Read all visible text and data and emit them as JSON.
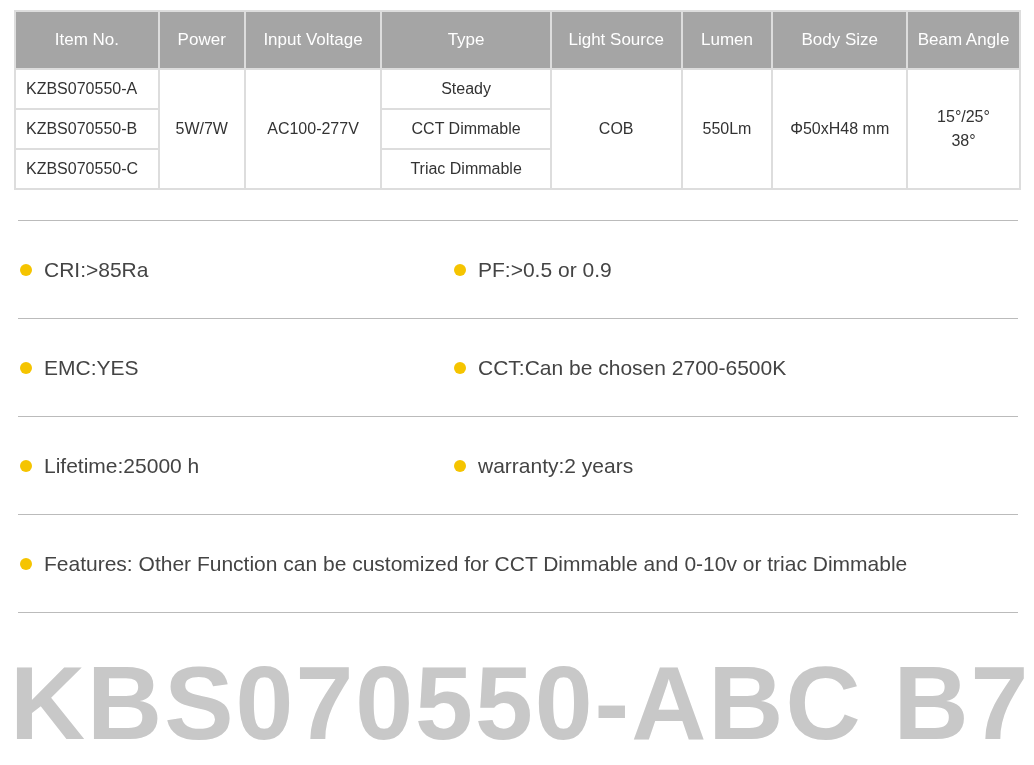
{
  "table": {
    "columns": [
      "Item No.",
      "Power",
      "Input Voltage",
      "Type",
      "Light Source",
      "Lumen",
      "Body Size",
      "Beam Angle"
    ],
    "item_numbers": [
      "KZBS070550-A",
      "KZBS070550-B",
      "KZBS070550-C"
    ],
    "power": "5W/7W",
    "input_voltage": "AC100-277V",
    "types": [
      "Steady",
      "CCT Dimmable",
      "Triac Dimmable"
    ],
    "light_source": "COB",
    "lumen": "550Lm",
    "body_size": "Φ50xH48 mm",
    "beam_angle": "15°/25°\n38°"
  },
  "features": [
    [
      "CRI:>85Ra",
      "PF:>0.5 or 0.9"
    ],
    [
      "EMC:YES",
      "CCT:Can be chosen 2700-6500K"
    ],
    [
      "Lifetime:25000 h",
      "warranty:2 years"
    ],
    [
      "Features: Other Function can be customized for CCT Dimmable and 0-10v or triac Dimmable"
    ]
  ],
  "model_title": "KBS070550-ABC B7"
}
